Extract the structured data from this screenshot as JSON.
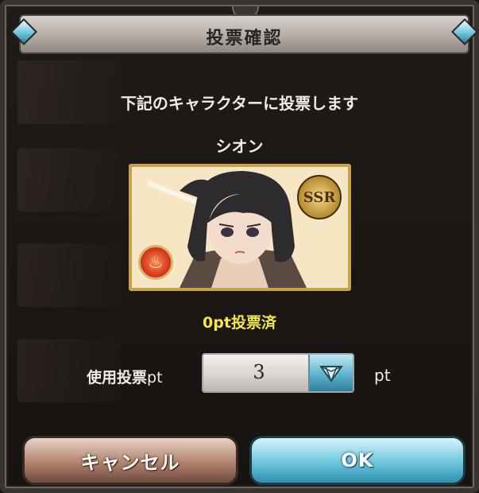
{
  "dialog": {
    "title": "投票確認",
    "message": "下記のキャラクターに投票します",
    "character_name": "シオン",
    "rarity_badge": "SSR",
    "element_icon": "fire-element-icon",
    "votes_status": "0pt投票済",
    "use_votes_label": "使用投票",
    "use_votes_unit_inline": "pt",
    "selected_points": "3",
    "points_unit": "pt",
    "cancel_label": "キャンセル",
    "ok_label": "OK"
  },
  "colors": {
    "accent_gem": "#6fc6dc",
    "votes_text": "#f5e64a",
    "ok_button": "#6cc6de",
    "cancel_button": "#b0846e"
  }
}
